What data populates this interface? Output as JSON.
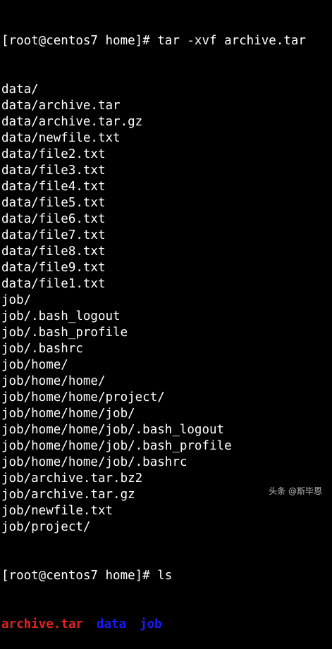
{
  "terminal": {
    "prompt1": "[root@centos7 home]# tar -xvf archive.tar",
    "output": [
      "data/",
      "data/archive.tar",
      "data/archive.tar.gz",
      "data/newfile.txt",
      "data/file2.txt",
      "data/file3.txt",
      "data/file4.txt",
      "data/file5.txt",
      "data/file6.txt",
      "data/file7.txt",
      "data/file8.txt",
      "data/file9.txt",
      "data/file1.txt",
      "job/",
      "job/.bash_logout",
      "job/.bash_profile",
      "job/.bashrc",
      "job/home/",
      "job/home/home/",
      "job/home/home/project/",
      "job/home/home/job/",
      "job/home/home/job/.bash_logout",
      "job/home/home/job/.bash_profile",
      "job/home/home/job/.bashrc",
      "job/archive.tar.bz2",
      "job/archive.tar.gz",
      "job/newfile.txt",
      "job/project/"
    ],
    "prompt2": "[root@centos7 home]# ls",
    "ls_entries": {
      "file": "archive.tar",
      "dir1": "data",
      "dir2": "job"
    },
    "colors": {
      "background": "#000000",
      "text": "#ffffff",
      "archive": "#e32020",
      "directory": "#1a1aff"
    }
  },
  "watermark": "头条 @斯毕恩"
}
